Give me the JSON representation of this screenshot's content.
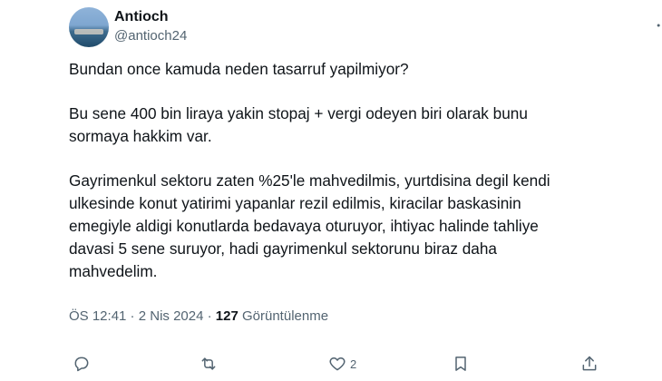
{
  "author": {
    "name": "Antioch",
    "handle": "@antioch24"
  },
  "tweet": {
    "paragraphs": [
      "Bundan once kamuda neden tasarruf yapilmiyor?",
      "Bu sene 400 bin liraya yakin stopaj + vergi odeyen biri olarak bunu\nsormaya hakkim var.",
      "Gayrimenkul sektoru zaten %25'le mahvedilmis, yurtdisina degil kendi\nulkesinde konut yatirimi yapanlar rezil edilmis, kiracilar baskasinin\nemegiyle aldigi konutlarda bedavaya oturuyor, ihtiyac halinde tahliye\ndavasi 5 sene suruyor, hadi gayrimenkul sektorunu biraz daha\nmahvedelim."
    ]
  },
  "meta": {
    "time": "ÖS 12:41",
    "sep1": " · ",
    "date": "2 Nis 2024",
    "sep2": " · ",
    "views_count": "127",
    "views_label": " Görüntülenme"
  },
  "actions": {
    "reply_icon": "reply-icon",
    "retweet_icon": "retweet-icon",
    "like_icon": "heart-icon",
    "like_count": "2",
    "bookmark_icon": "bookmark-icon",
    "share_icon": "share-icon",
    "more_icon": "more-icon"
  },
  "colors": {
    "text": "#0f1419",
    "muted": "#536471",
    "background": "#ffffff"
  }
}
